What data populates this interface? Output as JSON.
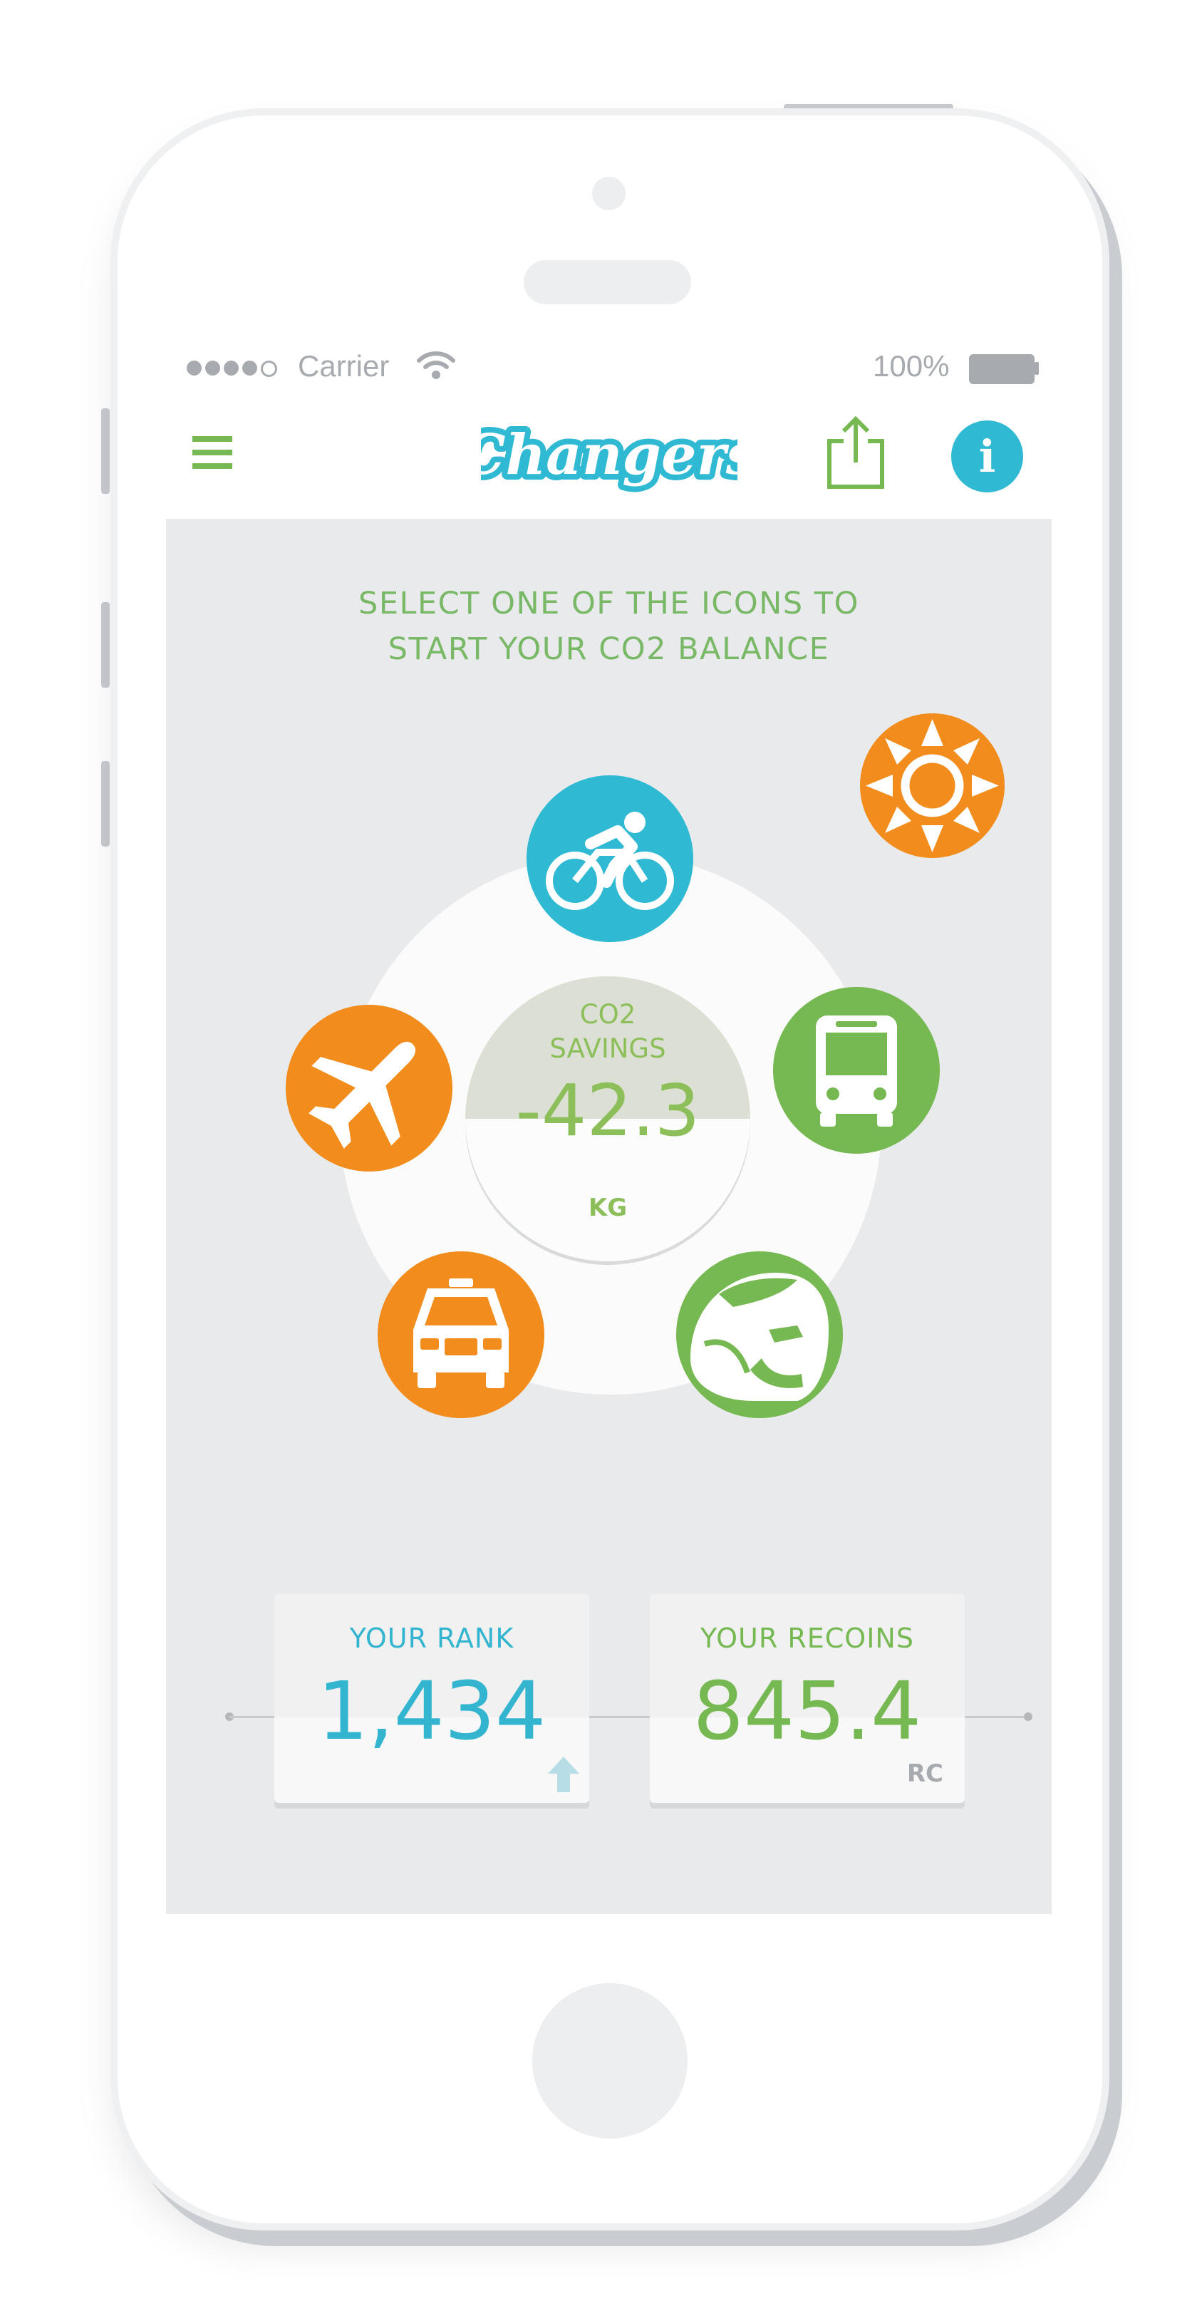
{
  "status_bar": {
    "carrier": "Carrier",
    "battery_percent": "100%",
    "signal_bars_filled": 4,
    "signal_bars_total": 5
  },
  "header": {
    "logo_text": "Changers",
    "menu_icon": "hamburger-menu-icon",
    "share_icon": "share-icon",
    "info_icon": "info-icon",
    "info_label": "i"
  },
  "main": {
    "instruction_line1": "SELECT ONE OF THE ICONS TO",
    "instruction_line2": "START YOUR CO2 BALANCE",
    "co2": {
      "label_line1": "CO2",
      "label_line2": "SAVINGS",
      "value": "-42.3",
      "unit": "KG"
    },
    "modes": [
      {
        "name": "bicycle",
        "icon": "bicycle-icon",
        "color": "#2fb9d3"
      },
      {
        "name": "bus",
        "icon": "bus-icon",
        "color": "#76b852"
      },
      {
        "name": "train",
        "icon": "train-icon",
        "color": "#76b852"
      },
      {
        "name": "car",
        "icon": "car-icon",
        "color": "#f28c1c"
      },
      {
        "name": "plane",
        "icon": "plane-icon",
        "color": "#f28c1c"
      },
      {
        "name": "sun",
        "icon": "sun-icon",
        "color": "#f28c1c"
      }
    ]
  },
  "stats": {
    "rank_label": "YOUR RANK",
    "rank_value": "1,434",
    "rank_trend_icon": "arrow-up-icon",
    "recoins_label": "YOUR RECOINS",
    "recoins_value": "845.4",
    "recoins_unit": "RC"
  },
  "colors": {
    "accent_blue": "#2fb9d3",
    "accent_green": "#76b852",
    "accent_orange": "#f28c1c",
    "text_green": "#79b866",
    "text_blue": "#33b5cf"
  }
}
